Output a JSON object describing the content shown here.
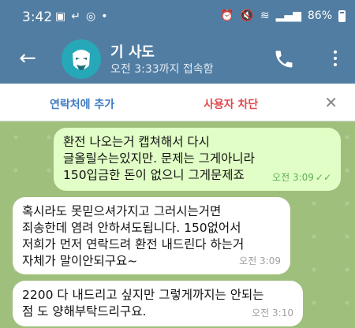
{
  "status_bar": {
    "time": "3:42",
    "battery": "86%"
  },
  "header": {
    "name": "기 사도",
    "status": "오전 3:33까지 접속함"
  },
  "action_bar": {
    "add_contact": "연락처에 추가",
    "block_user": "사용자 차단"
  },
  "messages": [
    {
      "direction": "outgoing",
      "lines": [
        "환전 나오는거 캡쳐해서 다시",
        "글올릴수는있지만. 문제는 그게아니라",
        "150입금한 돈이 없으니 그게문제죠"
      ],
      "time": "오전 3:09",
      "read": true
    },
    {
      "direction": "incoming",
      "lines": [
        "혹시라도 못믿으셔가지고 그러시는거면",
        "죄송한데 염려 안하셔도됩니다. 150없어서",
        "저희가 먼저 연락드려 환전 내드린다 하는거",
        "자체가 말이안되구요~"
      ],
      "time": "오전 3:09"
    },
    {
      "direction": "incoming",
      "lines": [
        "2200 다 내드리고 싶지만 그렇게까지는 안되는",
        "점 도 양해부탁드리구요."
      ],
      "time": "오전 3:10"
    }
  ],
  "colors": {
    "header_bg": "#517da2",
    "chat_bg": "#9fbf7c",
    "outgoing_bubble": "#e1fec6",
    "incoming_bubble": "#ffffff",
    "add_contact": "#3d7cc2",
    "block_user": "#e0494d"
  }
}
